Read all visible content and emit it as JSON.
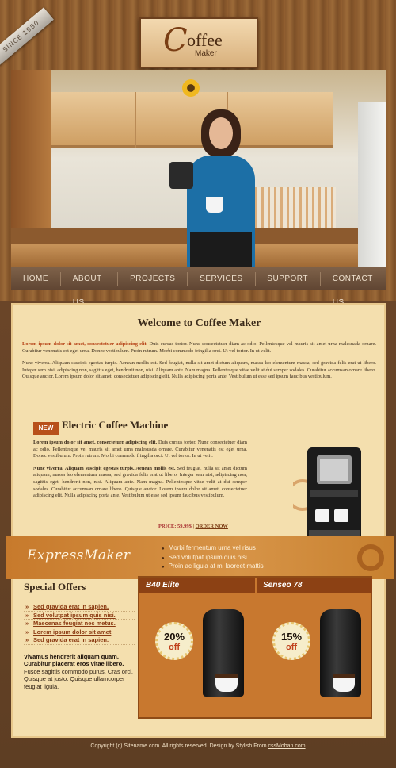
{
  "header": {
    "ribbon": "SINCE 1980",
    "logo_c": "C",
    "logo_offee": "offee",
    "logo_maker": "Maker"
  },
  "nav": {
    "items": [
      "HOME",
      "ABOUT US",
      "PROJECTS",
      "SERVICES",
      "SUPPORT",
      "CONTACT US"
    ]
  },
  "welcome": {
    "title": "Welcome to Coffee Maker",
    "p1_bold": "Lorem ipsum dolor sit amet, consectetuer adipiscing elit.",
    "p1_rest": " Duis cursus tortor. Nunc consectetuer diam ac odio. Pellentesque vel mauris sit amet urna malesuada ornare. Curabitur venenatis est eget urna. Donec vestibulum. Proin rutrum. Morbi commodo fringilla orci. Ut vel tortor. In ut velit.",
    "p2": "Nunc viverra. Aliquam suscipit egestas turpis. Aenean mollis est. Sed feugiat, nulla sit amet dictum aliquam, massa leo elementum massa, sed gravida felis erat ut libero. Integer sem nisi, adipiscing non, sagittis eget, hendrerit non, nisi. Aliquam ante. Nam magna. Pellentesque vitae velit at dui semper sodales. Curabitur accumsan ornare libero. Quisque auctor. Lorem ipsum dolor sit amet, consectetuer adipiscing elit. Nulla adipiscing porta ante. Vestibulum ut esse sed ipsum faucibus vestibulum."
  },
  "machine": {
    "badge": "NEW",
    "title": "Electric Coffee Machine",
    "p1_bold": "Lorem ipsum dolor sit amet, consectetuer adipiscing elit.",
    "p1_rest": " Duis cursus tortor. Nunc consectetuer diam ac odio. Pellentesque vel mauris sit amet urna malesuada ornare. Curabitur venenatis est eget urna. Donec vestibulum. Proin rutrum. Morbi commodo fringilla orci. Ut vel tortor. In ut velit.",
    "p2_bold": "Nunc viverra. Aliquam suscipit egestas turpis. Aenean mollis est.",
    "p2_rest": " Sed feugiat, nulla sit amet dictum aliquam, massa leo elementum massa, sed gravida felis erat ut libero. Integer sem nisi, adipiscing non, sagittis eget, hendrerit non, nisi. Aliquam ante. Nam magna. Pellentesque vitae velit at dui semper sodales. Curabitur accumsan ornare libero. Quisque auctor. Lorem ipsum dolor sit amet, consectetuer adipiscing elit. Nulla adipiscing porta ante. Vestibulum ut esse sed ipsum faucibus vestibulum.",
    "price_label": "PRICE:",
    "price_value": "59.99$",
    "order": "ORDER NOW"
  },
  "express": {
    "title": "ExpressMaker",
    "items": [
      "Morbi fermentum urna vel risus",
      "Sed volutpat ipsum quis nisi",
      "Proin ac ligula at mi laoreet mattis"
    ]
  },
  "special": {
    "title": "Special Offers",
    "links": [
      "Sed gravida erat in sapien.",
      "Sed volutpat ipsum quis nisi.",
      "Maecenas feugiat nec metus.",
      "Lorem ipsum dolor sit amet",
      "Sed gravida erat in sapien."
    ],
    "tail_bold": "Vivamus hendrerit aliquam quam. Curabitur placerat eros vitae libero.",
    "tail_rest": " Fusce sagittis commodo purus. Cras orci. Quisque at justo. Quisque ullamcorper feugiat ligula."
  },
  "offers": [
    {
      "name": "B40 Elite",
      "pct": "20%",
      "off": "off"
    },
    {
      "name": "Senseo 78",
      "pct": "15%",
      "off": "off"
    }
  ],
  "footer": {
    "text": "Copyright (c) Sitename.com. All rights reserved. Design by Stylish From ",
    "link": "cssMoban.com"
  }
}
